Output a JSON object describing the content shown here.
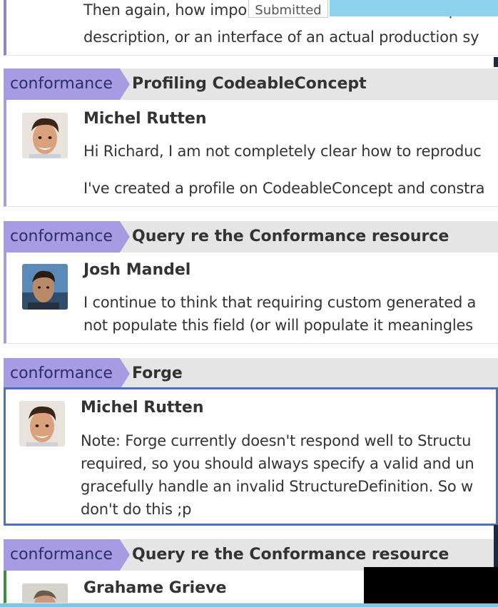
{
  "top_message": {
    "line1": "Then again, how important this difference is is depen",
    "line2": "description, or an interface of an actual production sy",
    "submitted_label": "Submitted"
  },
  "blocks": [
    {
      "stream": "conformance",
      "topic": "Profiling CodeableConcept",
      "sender": "Michel Rutten",
      "avatar": "avatar-michel",
      "lines": [
        "Hi Richard, I am not completely clear how to reproduc",
        "I've created a profile on CodeableConcept and constra"
      ]
    },
    {
      "stream": "conformance",
      "topic": "Query re the Conformance resource",
      "sender": "Josh Mandel",
      "avatar": "avatar-josh",
      "lines": [
        "I continue to think that requiring custom generated a",
        "not populate this field (or will populate it meaningles"
      ]
    },
    {
      "stream": "conformance",
      "topic": "Forge",
      "sender": "Michel Rutten",
      "avatar": "avatar-michel",
      "lines": [
        "Note: Forge currently doesn't respond well to Structu",
        "required, so you should always specify a valid and un",
        "gracefully handle an invalid StructureDefinition. So w",
        "don't do this ;p"
      ]
    },
    {
      "stream": "conformance",
      "topic": "Query re the Conformance resource",
      "sender": "Grahame Grieve",
      "avatar": "avatar-grahame",
      "lines": []
    }
  ],
  "colors": {
    "stream_bg": "#a79ce4",
    "header_bg": "#e5e5e5",
    "selected_border": "#4b72b8"
  }
}
